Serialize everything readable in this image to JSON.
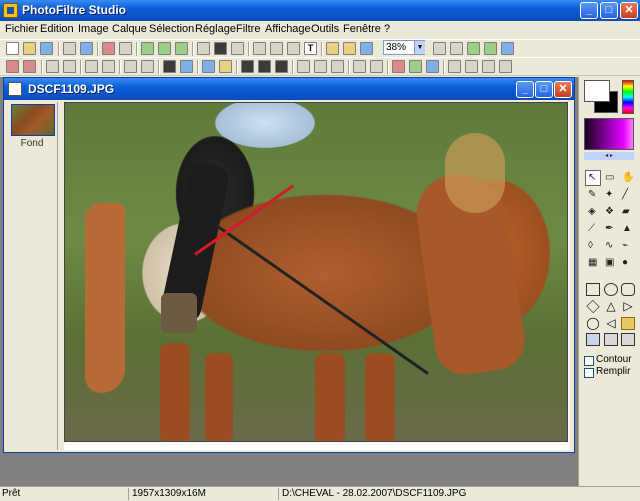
{
  "app": {
    "title": "PhotoFiltre Studio",
    "window_controls": {
      "minimize": "_",
      "maximize": "□",
      "close": "✕"
    }
  },
  "menu": [
    "Fichier",
    "Edition",
    "Image",
    "Calque",
    "Sélection",
    "Réglage",
    "Filtre",
    "Affichage",
    "Outils",
    "Fenêtre",
    "?"
  ],
  "toolbar": {
    "zoom_value": "38%",
    "zoom_arrow": "▼",
    "text_tool_glyph": "T"
  },
  "document": {
    "title": "DSCF1109.JPG",
    "window_controls": {
      "minimize": "_",
      "maximize": "□",
      "close": "✕"
    },
    "layers": [
      {
        "label": "Fond"
      }
    ]
  },
  "palette": {
    "foreground": "#ffffff",
    "background": "#000000",
    "arrows": "◂ ▸"
  },
  "tools": [
    {
      "name": "selection-arrow-icon",
      "glyph": "↖"
    },
    {
      "name": "selection-rect-icon",
      "glyph": "▭"
    },
    {
      "name": "hand-icon",
      "glyph": "✋"
    },
    {
      "name": "eyedropper-icon",
      "glyph": "✎"
    },
    {
      "name": "magic-wand-icon",
      "glyph": "✦"
    },
    {
      "name": "line-icon",
      "glyph": "╱"
    },
    {
      "name": "fill-bucket-icon",
      "glyph": "◈"
    },
    {
      "name": "spray-icon",
      "glyph": "❖"
    },
    {
      "name": "eraser-icon",
      "glyph": "▰"
    },
    {
      "name": "brush-icon",
      "glyph": "⟋"
    },
    {
      "name": "pen-icon",
      "glyph": "✒"
    },
    {
      "name": "stamp-icon",
      "glyph": "▲"
    },
    {
      "name": "drop-icon",
      "glyph": "◊"
    },
    {
      "name": "smudge-icon",
      "glyph": "∿"
    },
    {
      "name": "clone-icon",
      "glyph": "⌁"
    },
    {
      "name": "pattern-icon",
      "glyph": "▦"
    },
    {
      "name": "portrait-icon",
      "glyph": "▣"
    },
    {
      "name": "strawberry-icon",
      "glyph": "●"
    }
  ],
  "options": {
    "contour": "Contour",
    "remplir": "Remplir"
  },
  "status": {
    "state": "Prêt",
    "dimensions": "1957x1309x16M",
    "path": "D:\\CHEVAL - 28.02.2007\\DSCF1109.JPG"
  },
  "colors": {
    "titlebar": "#0a54c8",
    "chrome": "#ece9d8",
    "workspace": "#808080"
  }
}
